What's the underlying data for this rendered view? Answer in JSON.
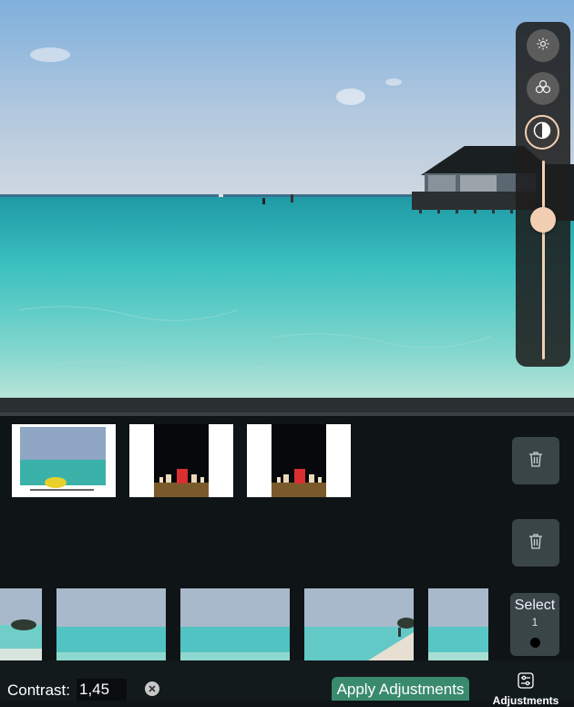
{
  "adjustment_tools": [
    {
      "icon": "sun-icon",
      "state": "inactive"
    },
    {
      "icon": "color-circles-icon",
      "state": "inactive"
    },
    {
      "icon": "contrast-icon",
      "state": "active"
    }
  ],
  "contrast_slider": {
    "level_fraction": 0.3
  },
  "selected_photos": [
    {
      "kind": "beach-kayak"
    },
    {
      "kind": "dinner-table"
    },
    {
      "kind": "dinner-table"
    }
  ],
  "filmstrip": [
    {
      "kind": "beach-island"
    },
    {
      "kind": "ocean"
    },
    {
      "kind": "ocean"
    },
    {
      "kind": "beach-people"
    },
    {
      "kind": "ocean"
    }
  ],
  "select_button": {
    "label": "Select",
    "count": "1"
  },
  "bottom_bar": {
    "contrast_label": "Contrast:",
    "contrast_value": "1,45",
    "apply_label": "Apply Adjustments",
    "adjustments_tab_label": "Adjustments"
  },
  "colors": {
    "accent": "#f2cfb3",
    "apply": "#3a8a6e",
    "panel": "#0f1416"
  }
}
